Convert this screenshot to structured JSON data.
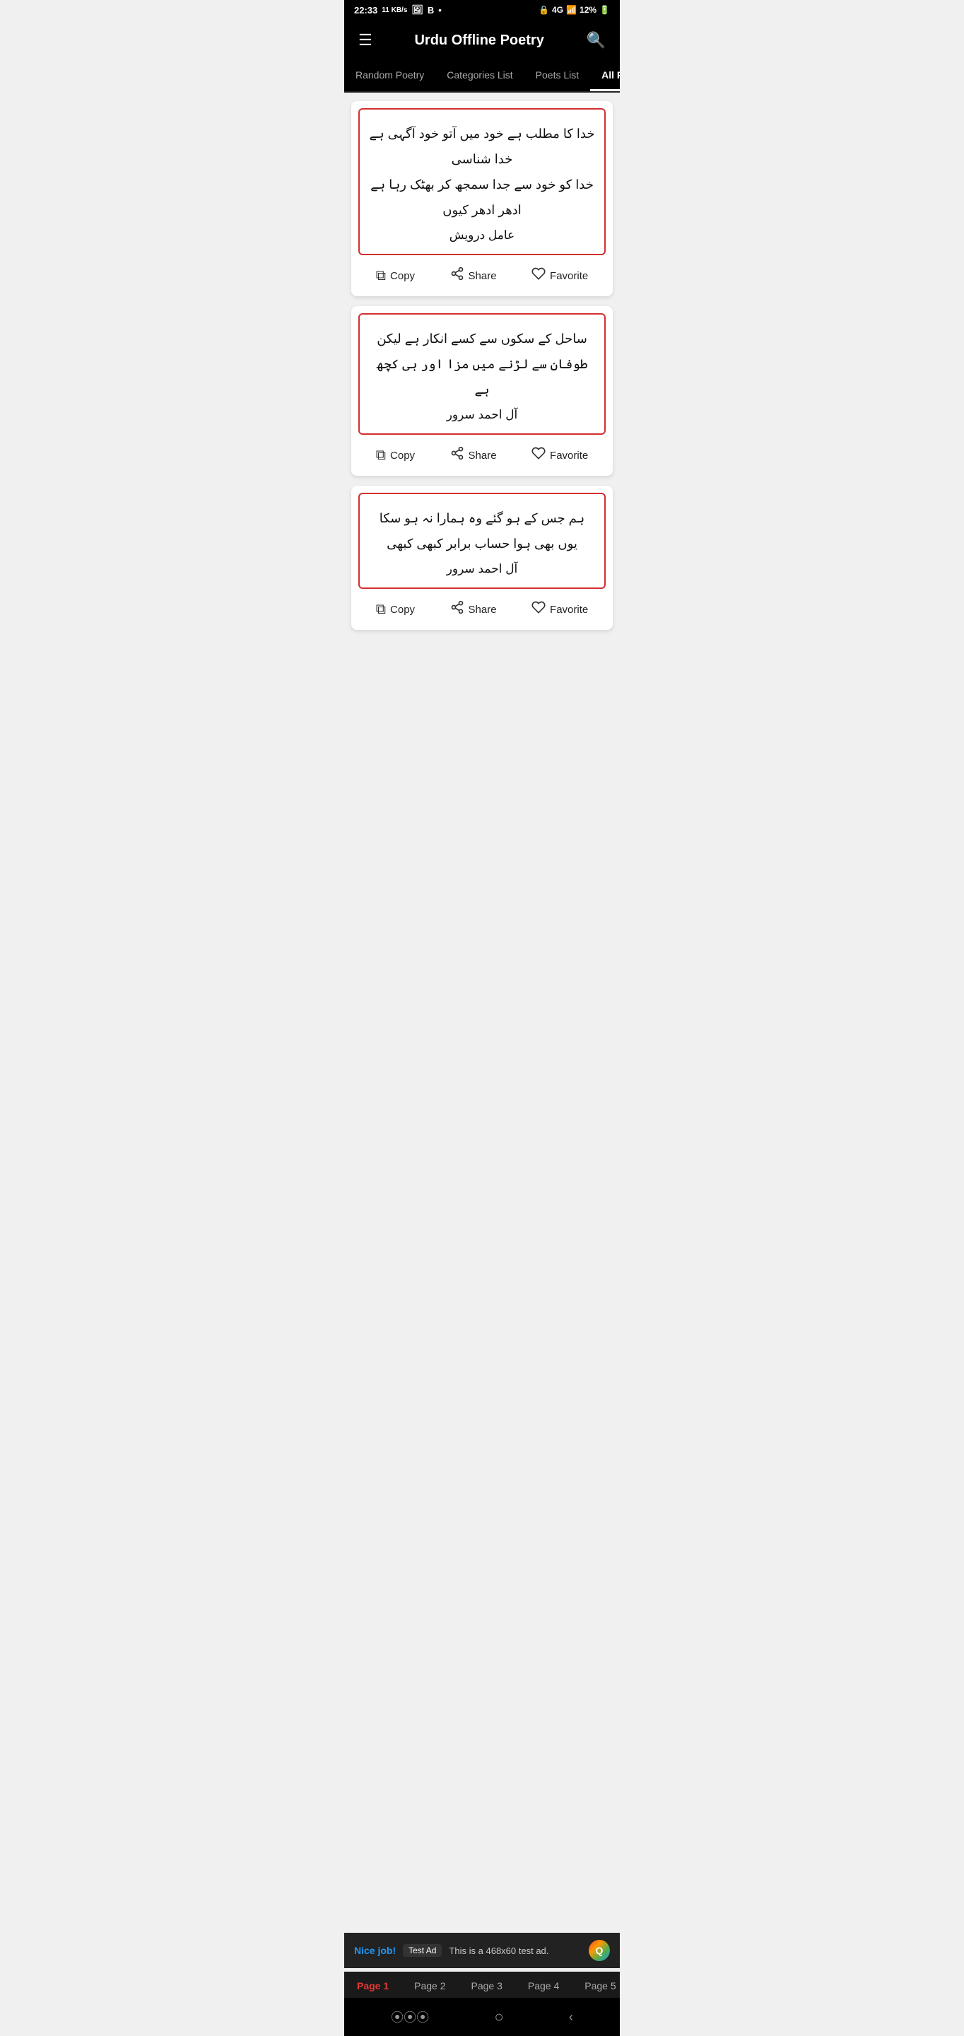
{
  "statusBar": {
    "time": "22:33",
    "dataSpeed": "11 KB/s",
    "network": "4G",
    "battery": "12%"
  },
  "appBar": {
    "title": "Urdu Offline Poetry",
    "menuIcon": "menu-icon",
    "searchIcon": "search-icon"
  },
  "tabs": [
    {
      "id": "random",
      "label": "Random Poetry",
      "active": false
    },
    {
      "id": "categories",
      "label": "Categories List",
      "active": false
    },
    {
      "id": "poets",
      "label": "Poets List",
      "active": false
    },
    {
      "id": "all",
      "label": "All Poetry",
      "active": true
    }
  ],
  "poems": [
    {
      "id": 1,
      "line1": "خدا کا مطلب ہے خود میں آتو خود آگہی ہے خدا شناسی",
      "line2": "خدا کو خود سے جدا سمجھ کر بھٹک رہا ہے ادھر ادھر کیوں",
      "poet": "عامل درویش",
      "copyLabel": "Copy",
      "shareLabel": "Share",
      "favoriteLabel": "Favorite"
    },
    {
      "id": 2,
      "line1": "ساحل کے سکوں سے کسے انکار ہے لیکن",
      "line2": "طوفان سے لڑنے میں مزا اور ہی کچھ ہے",
      "poet": "آل احمد سرور",
      "copyLabel": "Copy",
      "shareLabel": "Share",
      "favoriteLabel": "Favorite"
    },
    {
      "id": 3,
      "line1": "ہم جس کے ہو گئے وہ ہمارا نہ ہو سکا",
      "line2": "یوں بھی ہوا حساب برابر کبھی کبھی",
      "poet": "آل احمد سرور",
      "copyLabel": "Copy",
      "shareLabel": "Share",
      "favoriteLabel": "Favorite"
    }
  ],
  "pages": [
    {
      "label": "Page  1",
      "active": true
    },
    {
      "label": "Page  2",
      "active": false
    },
    {
      "label": "Page  3",
      "active": false
    },
    {
      "label": "Page  4",
      "active": false
    },
    {
      "label": "Page  5",
      "active": false
    }
  ],
  "ad": {
    "badge": "Test Ad",
    "niceLabel": "Nice job!",
    "description": "This is a 468x60 test ad."
  },
  "actions": {
    "copyIcon": "📋",
    "shareIcon": "share-icon",
    "favoriteIcon": "heart-icon"
  }
}
